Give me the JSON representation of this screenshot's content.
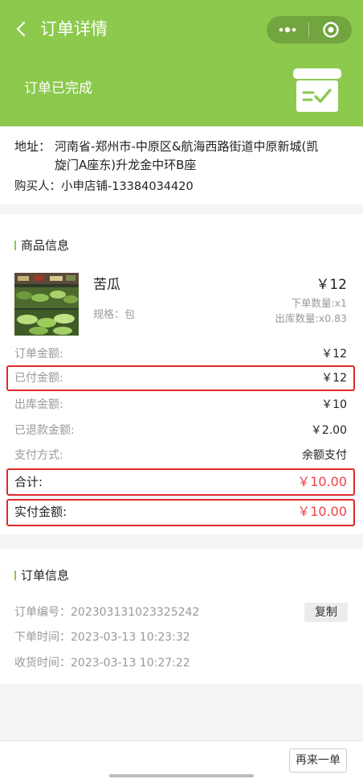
{
  "nav": {
    "title": "订单详情",
    "back_icon": "chevron-left-icon",
    "more_icon": "more-dots-icon",
    "close_icon": "target-close-icon"
  },
  "status": {
    "text": "订单已完成",
    "icon": "completed-box-icon"
  },
  "address": {
    "label": "地址：",
    "value": "河南省-郑州市-中原区&航海西路街道中原新城(凯旋门A座东)升龙金中环B座",
    "buyer_label": "购买人：",
    "buyer_value": "小申店铺-13384034420"
  },
  "goods": {
    "section_title": "商品信息",
    "product": {
      "name": "苦瓜",
      "spec": "规格：包",
      "price": "￥12",
      "order_qty": "下单数量:x1",
      "out_qty": "出库数量:x0.83"
    },
    "amounts": [
      {
        "label": "订单金额:",
        "value": "￥12"
      },
      {
        "label": "已付金额:",
        "value": "￥12"
      },
      {
        "label": "出库金额:",
        "value": "￥10"
      },
      {
        "label": "已退款金额:",
        "value": "￥2.00"
      },
      {
        "label": "支付方式:",
        "value": "余额支付"
      },
      {
        "label": "合计:",
        "value": "￥10.00"
      },
      {
        "label": "实付金额:",
        "value": "￥10.00"
      }
    ]
  },
  "order": {
    "section_title": "订单信息",
    "order_no": "订单编号：202303131023325242",
    "copy_label": "复制",
    "order_time": "下单时间：2023-03-13 10:23:32",
    "receive_time": "收货时间：2023-03-13 10:27:22"
  },
  "footer": {
    "again_label": "再来一单"
  },
  "colors": {
    "brand_green": "#8cc94d",
    "accent_red": "#e8434a",
    "highlight_border": "#e0282a"
  }
}
